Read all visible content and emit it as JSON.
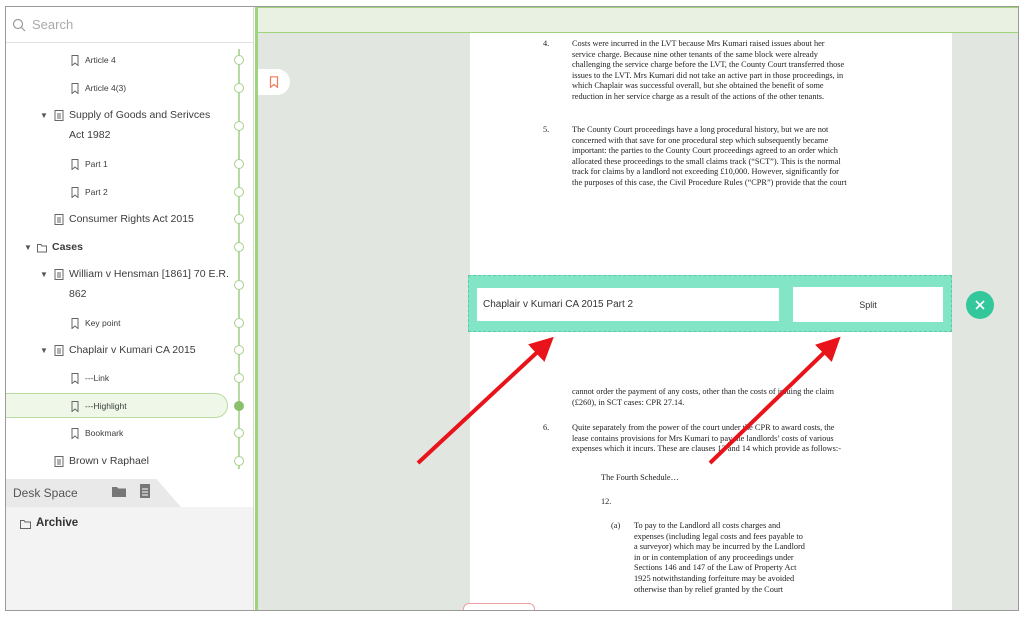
{
  "sidebar": {
    "search_placeholder": "Search",
    "tree": [
      {
        "label": "Article 4",
        "type": "bookmark"
      },
      {
        "label": "Article 4(3)",
        "type": "bookmark"
      },
      {
        "label_line1": "Supply of Goods and Serivces",
        "label_line2": "Act 1982",
        "type": "document"
      },
      {
        "label": "Part 1",
        "type": "bookmark"
      },
      {
        "label": "Part 2",
        "type": "bookmark"
      },
      {
        "label": "Consumer Rights Act 2015",
        "type": "document"
      },
      {
        "label": "Cases",
        "type": "folder"
      },
      {
        "label_line1": "William v Hensman [1861] 70 E.R.",
        "label_line2": "862",
        "type": "document"
      },
      {
        "label": "Key point",
        "type": "bookmark"
      },
      {
        "label": "Chaplair v Kumari CA 2015",
        "type": "document"
      },
      {
        "label": "---Link",
        "type": "bookmark"
      },
      {
        "label": "---Highlight",
        "type": "bookmark",
        "selected": true
      },
      {
        "label": "Bookmark",
        "type": "bookmark"
      },
      {
        "label": "Brown v Raphael",
        "type": "document"
      }
    ],
    "desk_space_label": "Desk Space",
    "archive_label": "Archive"
  },
  "document": {
    "p4_num": "4.",
    "p4_lines": [
      "Costs were incurred in the LVT because Mrs Kumari raised issues about her",
      "service charge.   Because nine other tenants of the same block were already",
      "challenging the service charge before the LVT, the County Court transferred those",
      "issues to the LVT.  Mrs Kumari did not take an active part in those proceedings, in",
      "which Chaplair was successful overall, but she obtained the benefit of some",
      "reduction in her service charge as a result of the actions of the other tenants."
    ],
    "p5_num": "5.",
    "p5_lines": [
      "The County Court proceedings have a long procedural history, but we are not",
      "concerned with that save for one procedural step which subsequently became",
      "important:  the parties to the County Court proceedings agreed to an order which",
      "allocated these proceedings to the small claims track (“SCT”).  This is the normal",
      "track for claims by a landlord not exceeding £10,000.  However, significantly for",
      "the purposes of this case, the Civil Procedure Rules (“CPR”) provide that the court"
    ],
    "cont_lines": [
      "cannot order the payment of any costs, other than the costs of issuing the claim",
      "(£260), in SCT cases:  CPR 27.14."
    ],
    "p6_num": "6.",
    "p6_lines": [
      "Quite separately from the power of the court under the CPR to award costs, the",
      "lease contains provisions for Mrs Kumari to pay the landlords’ costs of various",
      "expenses which it incurs.  These are clauses 12 and 14 which provide as follows:-"
    ],
    "schedule_heading": "The Fourth Schedule…",
    "clause_num": "12.",
    "sub_a": "(a)",
    "sub_a_lines": [
      "To pay to the Landlord all costs charges and",
      "expenses (including legal costs and fees payable to",
      "a surveyor) which may be incurred by the Landlord",
      "in or in contemplation of any proceedings under",
      "Sections 146 and 147 of the Law of Property Act",
      "1925 notwithstanding forfeiture may be avoided",
      "otherwise than by relief granted by the Court"
    ]
  },
  "split": {
    "input_value": "Chaplair v Kumari CA 2015 Part 2",
    "button_label": "Split"
  },
  "colors": {
    "accent_green": "#9ed47c",
    "split_bar": "#81e5c6",
    "close_button": "#34c79c",
    "annotation_arrow": "#e8131b",
    "bookmark_icon": "#f07a5a"
  }
}
